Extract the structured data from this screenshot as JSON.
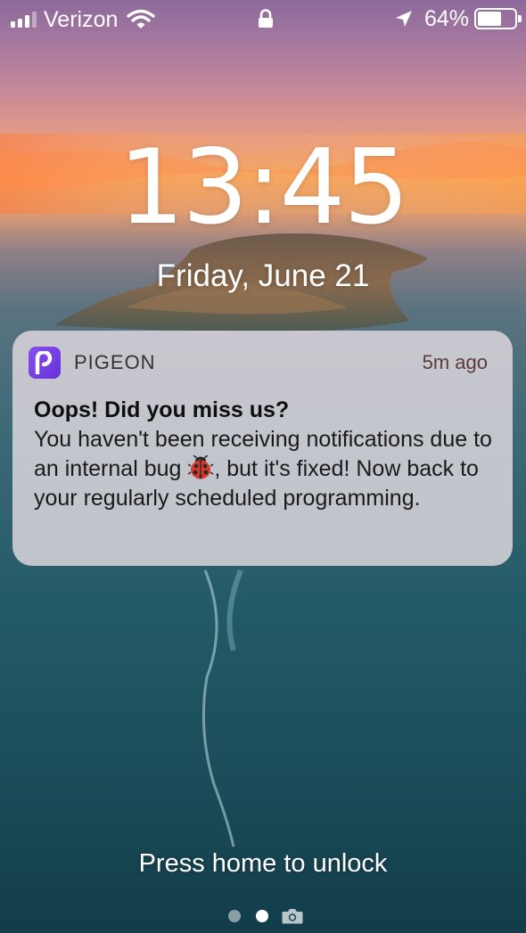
{
  "status_bar": {
    "signal_bars_filled": 3,
    "signal_bars_total": 4,
    "carrier": "Verizon",
    "wifi_icon": "wifi-icon",
    "lock_icon": "padlock-icon",
    "location_icon": "location-arrow-icon",
    "battery_percent": "64%",
    "battery_level": 0.64
  },
  "lock_screen": {
    "time": "13:45",
    "date": "Friday, June 21",
    "unlock_hint": "Press home to unlock",
    "page_dots": {
      "count": 2,
      "active_index": 1,
      "trailing_icon": "camera-icon"
    }
  },
  "notification": {
    "app_icon": "pigeon-app-icon",
    "app_name": "PIGEON",
    "time": "5m ago",
    "title": "Oops! Did you miss us?",
    "body_before_emoji": "You haven't been receiving notifications due to an internal bug ",
    "emoji": "ladybug-icon",
    "body_after_emoji": ", but it's fixed! Now back to your regularly scheduled programming."
  },
  "colors": {
    "app_icon_purple": "#7a40e6",
    "notification_background": "#e2dae0",
    "time_label": "#5b3c3a",
    "ocean": "#1d4e5a",
    "sunset": "#f7a55a"
  }
}
